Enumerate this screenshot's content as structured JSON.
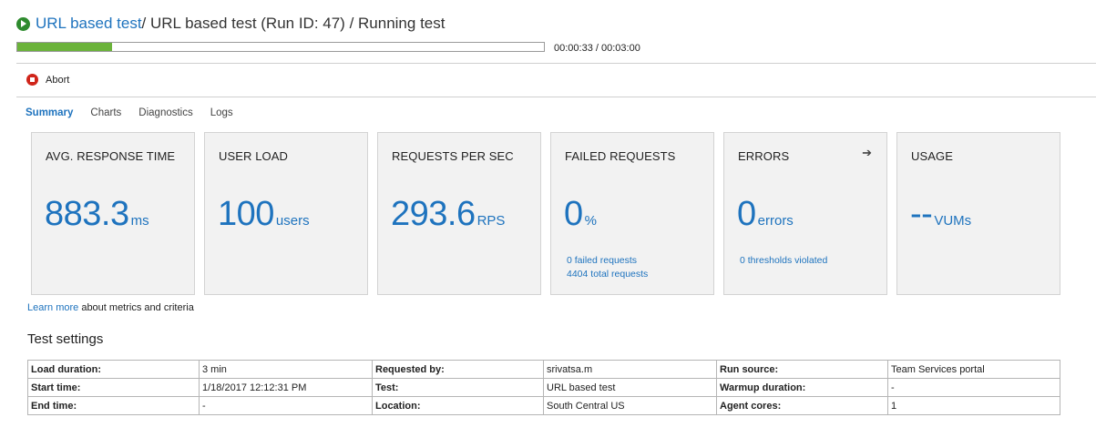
{
  "header": {
    "test_link": "URL based test",
    "breadcrumb_rest": " / URL based test (Run ID: 47) / Running test",
    "progress_fraction": 0.18,
    "timer": "00:00:33 / 00:03:00"
  },
  "toolbar": {
    "abort_label": "Abort"
  },
  "tabs": [
    "Summary",
    "Charts",
    "Diagnostics",
    "Logs"
  ],
  "cards": {
    "avg_response": {
      "title": "AVG. RESPONSE TIME",
      "value": "883.3",
      "unit": "ms"
    },
    "user_load": {
      "title": "USER LOAD",
      "value": "100",
      "unit": "users"
    },
    "rps": {
      "title": "REQUESTS PER SEC",
      "value": "293.6",
      "unit": "RPS"
    },
    "failed": {
      "title": "FAILED REQUESTS",
      "value": "0",
      "unit": "%",
      "sub1": "0 failed requests",
      "sub2": "4404 total requests"
    },
    "errors": {
      "title": "ERRORS",
      "value": "0",
      "unit": "errors",
      "sub1": "0 thresholds violated"
    },
    "usage": {
      "title": "USAGE",
      "value": "--",
      "unit": "VUMs"
    }
  },
  "learn": {
    "link": "Learn more",
    "text": " about metrics and criteria"
  },
  "settings": {
    "title": "Test settings",
    "rows": [
      [
        "Load duration:",
        "3 min",
        "Requested by:",
        "srivatsa.m",
        "Run source:",
        "Team Services portal"
      ],
      [
        "Start time:",
        "1/18/2017 12:12:31 PM",
        "Test:",
        "URL based test",
        "Warmup duration:",
        "-"
      ],
      [
        "End time:",
        "-",
        "Location:",
        "South Central US",
        "Agent cores:",
        "1"
      ]
    ]
  },
  "colors": {
    "accent": "#1e73be",
    "progress": "#6bb33a",
    "abort": "#d0251a",
    "run": "#2e8b2e"
  },
  "icons": [
    "play-circle-icon",
    "stop-circle-icon",
    "arrow-right-icon"
  ]
}
